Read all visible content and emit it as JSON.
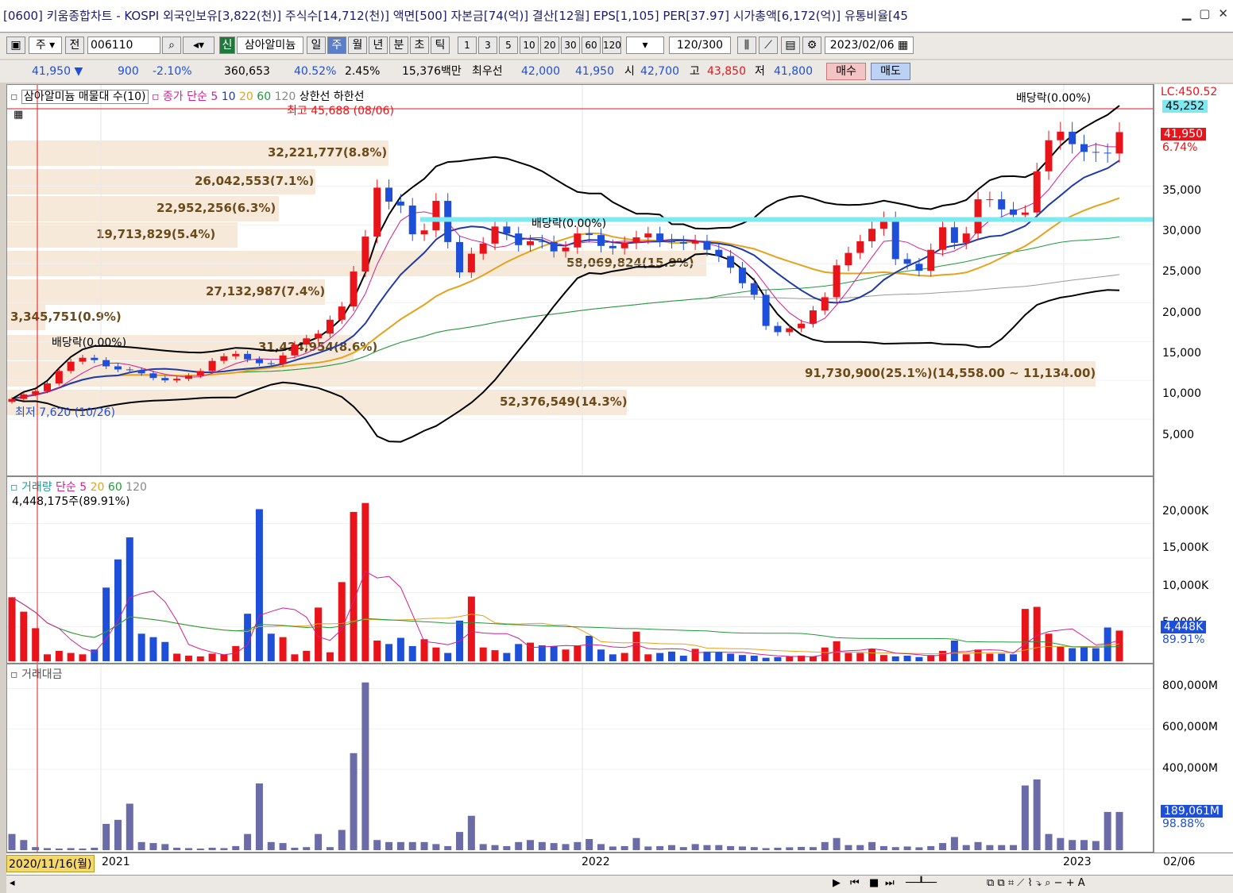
{
  "title": {
    "tab_no": "1",
    "text": "[0600] 키움종합차트 - KOSPI 외국인보유[3,822(천)] 주식수[14,712(천)] 액면[500] 자본금[74(억)] 결산[12월] EPS[1,105] PER[37.97] 시가총액[6,172(억)] 유통비율[45"
  },
  "toolbar": {
    "market": "주",
    "prev": "전",
    "code": "006110",
    "search_icon": "search-icon",
    "new_badge": "신",
    "name": "삼아알미늄",
    "periods": [
      "일",
      "주",
      "월",
      "년",
      "분",
      "초",
      "틱"
    ],
    "selected_period": "주",
    "intervals": [
      "1",
      "3",
      "5",
      "10",
      "20",
      "30",
      "60",
      "120"
    ],
    "count": "120",
    "count_total": "/300",
    "date": "2023/02/06"
  },
  "quote": {
    "price": "41,950",
    "arrow": "▼",
    "change": "900",
    "change_pct": "-2.10%",
    "volume": "360,653",
    "vol_ratio": "40.52%",
    "turnover": "2.45%",
    "amount": "15,376백만",
    "best_label": "최우선",
    "best_ask": "42,000",
    "best_bid": "41,950",
    "open_label": "시",
    "open": "42,700",
    "high_label": "고",
    "high": "43,850",
    "low_label": "저",
    "low": "41,800",
    "buy": "매수",
    "sell": "매도"
  },
  "price_panel": {
    "legend_profile": "삼아알미늄 매물대 수(10)",
    "legend_close": "종가 단순",
    "ma": [
      "5",
      "10",
      "20",
      "60",
      "120"
    ],
    "upper": "상한선",
    "lower": "하한선",
    "annotations": {
      "high": "최고 45,688 (08/06)",
      "low": "최저 7,620 (10/26)",
      "div1": "배당락(0.00%)",
      "div2": "배당락(0.00%)",
      "div3": "배당락(0.00%)"
    },
    "profile": [
      {
        "text": "32,221,777(8.8%)"
      },
      {
        "text": "26,042,553(7.1%)"
      },
      {
        "text": "22,952,256(6.3%)"
      },
      {
        "text": "19,713,829(5.4%)"
      },
      {
        "text": "58,069,824(15.9%)"
      },
      {
        "text": "27,132,987(7.4%)"
      },
      {
        "text": "3,345,751(0.9%)"
      },
      {
        "text": "31,424,954(8.6%)"
      },
      {
        "text": "91,730,900(25.1%)(14,558.00 ~ 11,134.00)"
      },
      {
        "text": "52,376,549(14.3%)"
      }
    ],
    "axis": [
      "35,000",
      "30,000",
      "25,000",
      "20,000",
      "15,000",
      "10,000",
      "5,000"
    ],
    "axis_lc": "LC:450.52",
    "axis_top": "45,252",
    "cur_price": "41,950",
    "cur_pct": "6.74%"
  },
  "volume_panel": {
    "legend": "거래량",
    "legend_ma": "단순",
    "ma": [
      "5",
      "20",
      "60",
      "120"
    ],
    "info": "4,448,175주(89.91%)",
    "axis": [
      "20,000K",
      "15,000K",
      "10,000K",
      "5,000K"
    ],
    "cur": "4,448K",
    "cur_pct": "89.91%"
  },
  "amount_panel": {
    "legend": "거래대금",
    "axis": [
      "800,000M",
      "600,000M",
      "400,000M"
    ],
    "cur": "189,061M",
    "cur_pct": "98.88%"
  },
  "xaxis": {
    "cursor": "2020/11/16(월)",
    "y2021": "2021",
    "y2022": "2022",
    "y2023": "2023",
    "end": "02/06"
  },
  "colors": {
    "up": "#e8141a",
    "down": "#1e4fd8",
    "bg": "#ffffff",
    "cyan": "#7fe9f2",
    "profile": "#f6e9d9"
  },
  "chart_data": {
    "type": "candlestick",
    "series_close": [
      7.6,
      8.2,
      8.6,
      9.6,
      11.2,
      12.4,
      12.9,
      12.6,
      11.8,
      11.4,
      11.3,
      10.9,
      10.3,
      10.0,
      10.2,
      10.6,
      11.2,
      12.5,
      13.1,
      13.4,
      12.7,
      12.2,
      12.1,
      13.2,
      14.6,
      15.4,
      16.0,
      17.8,
      19.5,
      24.0,
      28.5,
      34.8,
      33.0,
      32.5,
      28.8,
      29.3,
      33.1,
      27.8,
      23.9,
      26.3,
      27.6,
      29.8,
      28.9,
      27.4,
      27.9,
      27.8,
      26.6,
      27.1,
      28.9,
      28.7,
      27.3,
      27.0,
      27.7,
      28.4,
      28.9,
      28.0,
      27.8,
      27.6,
      27.9,
      26.8,
      26.0,
      24.5,
      22.5,
      21.0,
      17.0,
      16.2,
      16.7,
      17.3,
      19.0,
      20.7,
      24.8,
      26.4,
      27.9,
      29.5,
      30.8,
      25.6,
      25.0,
      24.1,
      26.8,
      29.7,
      27.7,
      28.9,
      33.3,
      33.3,
      32.0,
      31.3,
      31.6,
      36.9,
      40.9,
      42.0,
      40.4,
      39.4,
      39.3,
      39.2,
      41.95
    ],
    "volume_K": [
      9.3,
      7.2,
      4.8,
      1.0,
      1.5,
      1.2,
      1.0,
      1.7,
      10.7,
      14.8,
      18.0,
      4.0,
      3.5,
      2.8,
      1.1,
      0.8,
      0.7,
      1.1,
      1.0,
      2.2,
      6.9,
      22.1,
      4.0,
      3.5,
      1.0,
      1.5,
      7.8,
      1.3,
      11.5,
      21.7,
      23.0,
      3.0,
      2.5,
      3.4,
      2.2,
      3.2,
      2.0,
      1.2,
      5.9,
      9.4,
      2.0,
      1.6,
      1.2,
      2.5,
      2.7,
      2.3,
      2.2,
      1.7,
      2.3,
      3.7,
      1.7,
      1.0,
      1.2,
      4.3,
      1.0,
      1.2,
      1.4,
      0.8,
      1.8,
      1.4,
      1.3,
      1.1,
      0.9,
      0.8,
      0.5,
      0.6,
      0.7,
      0.8,
      0.7,
      2.0,
      2.9,
      1.2,
      1.2,
      1.8,
      0.9,
      0.7,
      0.8,
      0.6,
      0.9,
      1.5,
      3.0,
      1.0,
      1.7,
      1.1,
      1.1,
      1.0,
      7.6,
      7.9,
      4.0,
      2.1,
      1.9,
      2.0,
      1.9,
      4.9,
      4.448
    ],
    "amount_M": [
      80,
      50,
      15,
      10,
      8,
      10,
      8,
      12,
      130,
      150,
      230,
      40,
      35,
      30,
      12,
      10,
      8,
      12,
      10,
      20,
      80,
      330,
      40,
      35,
      12,
      15,
      80,
      15,
      100,
      480,
      830,
      50,
      40,
      40,
      40,
      40,
      30,
      20,
      90,
      170,
      30,
      25,
      20,
      40,
      50,
      40,
      35,
      30,
      40,
      55,
      30,
      18,
      20,
      60,
      18,
      20,
      25,
      15,
      30,
      25,
      25,
      20,
      18,
      15,
      10,
      12,
      14,
      16,
      15,
      40,
      60,
      25,
      25,
      40,
      20,
      15,
      18,
      14,
      20,
      35,
      65,
      25,
      40,
      25,
      25,
      25,
      320,
      350,
      80,
      60,
      50,
      50,
      45,
      189,
      189
    ],
    "ylim": [
      0,
      47
    ],
    "volume_ylim": [
      0,
      24
    ],
    "amount_ylim": [
      0,
      880
    ]
  }
}
